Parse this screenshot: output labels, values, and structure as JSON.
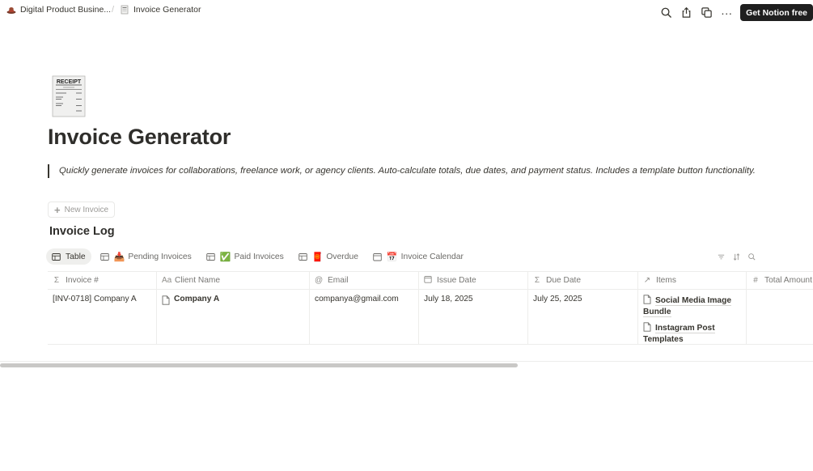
{
  "breadcrumb": {
    "workspace": "Digital Product Busine...",
    "separator": "/",
    "page": "Invoice Generator"
  },
  "topbar": {
    "icons": [
      "search-icon",
      "share-icon",
      "duplicate-icon",
      "more-icon"
    ],
    "more_label": "···",
    "cta_label": "Get Notion free"
  },
  "page": {
    "icon": "receipt-icon",
    "icon_text": {
      "heading": "RECEIPT"
    },
    "title": "Invoice Generator",
    "quote": "Quickly generate invoices for collaborations, freelance work, or agency clients. Auto-calculate totals, due dates, and payment status. Includes a template button functionality."
  },
  "new_button": {
    "icon": "plus-icon",
    "label": "New Invoice"
  },
  "database": {
    "title": "Invoice Log",
    "views": [
      {
        "label": "Table",
        "emoji": "",
        "active": true
      },
      {
        "label": "Pending Invoices",
        "emoji": "📥",
        "active": false
      },
      {
        "label": "Paid Invoices",
        "emoji": "✅",
        "active": false
      },
      {
        "label": "Overdue",
        "emoji": "🧧",
        "active": false
      },
      {
        "label": "Invoice Calendar",
        "emoji": "📅",
        "active": false
      }
    ],
    "tools": [
      "filter-icon",
      "sort-icon",
      "search-icon"
    ],
    "columns": [
      {
        "label": "Invoice #",
        "icon": "Σ"
      },
      {
        "label": "Client Name",
        "icon": "Aa"
      },
      {
        "label": "Email",
        "icon": "@"
      },
      {
        "label": "Issue Date",
        "icon": "calendar"
      },
      {
        "label": "Due Date",
        "icon": "Σ"
      },
      {
        "label": "Items",
        "icon": "↗"
      },
      {
        "label": "Total Amount",
        "icon": "#"
      }
    ],
    "rows": [
      {
        "invoice": "[INV-0718] Company A",
        "client": "Company A",
        "email": "companya@gmail.com",
        "issue_date": "July 18, 2025",
        "due_date": "July 25, 2025",
        "items": [
          "Social Media Image Bundle",
          "Instagram Post Templates"
        ],
        "total": ""
      }
    ]
  },
  "colors": {
    "text": "#37352f",
    "muted": "#787774",
    "border": "#ededeb",
    "cta_bg": "#1f1f1f",
    "active_view_bg": "#efefed"
  }
}
